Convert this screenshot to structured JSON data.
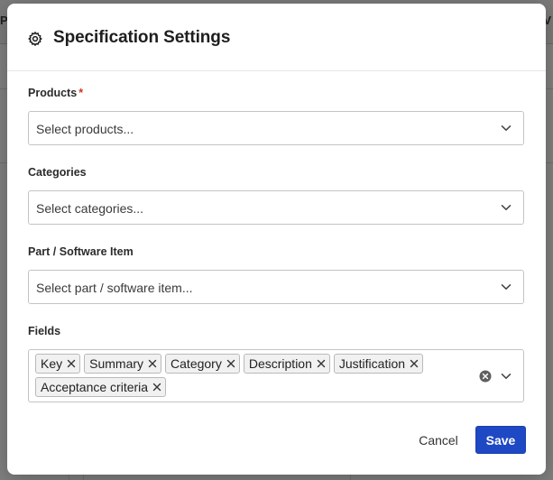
{
  "dialog": {
    "title": "Specification Settings",
    "icon": "gear-icon"
  },
  "background": {
    "left_edge_text": "P",
    "right_edge_text": "V"
  },
  "products": {
    "label": "Products",
    "required_mark": "*",
    "placeholder": "Select products..."
  },
  "categories": {
    "label": "Categories",
    "placeholder": "Select categories..."
  },
  "part": {
    "label": "Part / Software Item",
    "placeholder": "Select part / software item..."
  },
  "fields": {
    "label": "Fields",
    "selected": [
      "Key",
      "Summary",
      "Category",
      "Description",
      "Justification",
      "Acceptance criteria"
    ]
  },
  "actions": {
    "cancel_label": "Cancel",
    "save_label": "Save"
  },
  "colors": {
    "primary": "#1f48c4",
    "required": "#d4341e"
  }
}
